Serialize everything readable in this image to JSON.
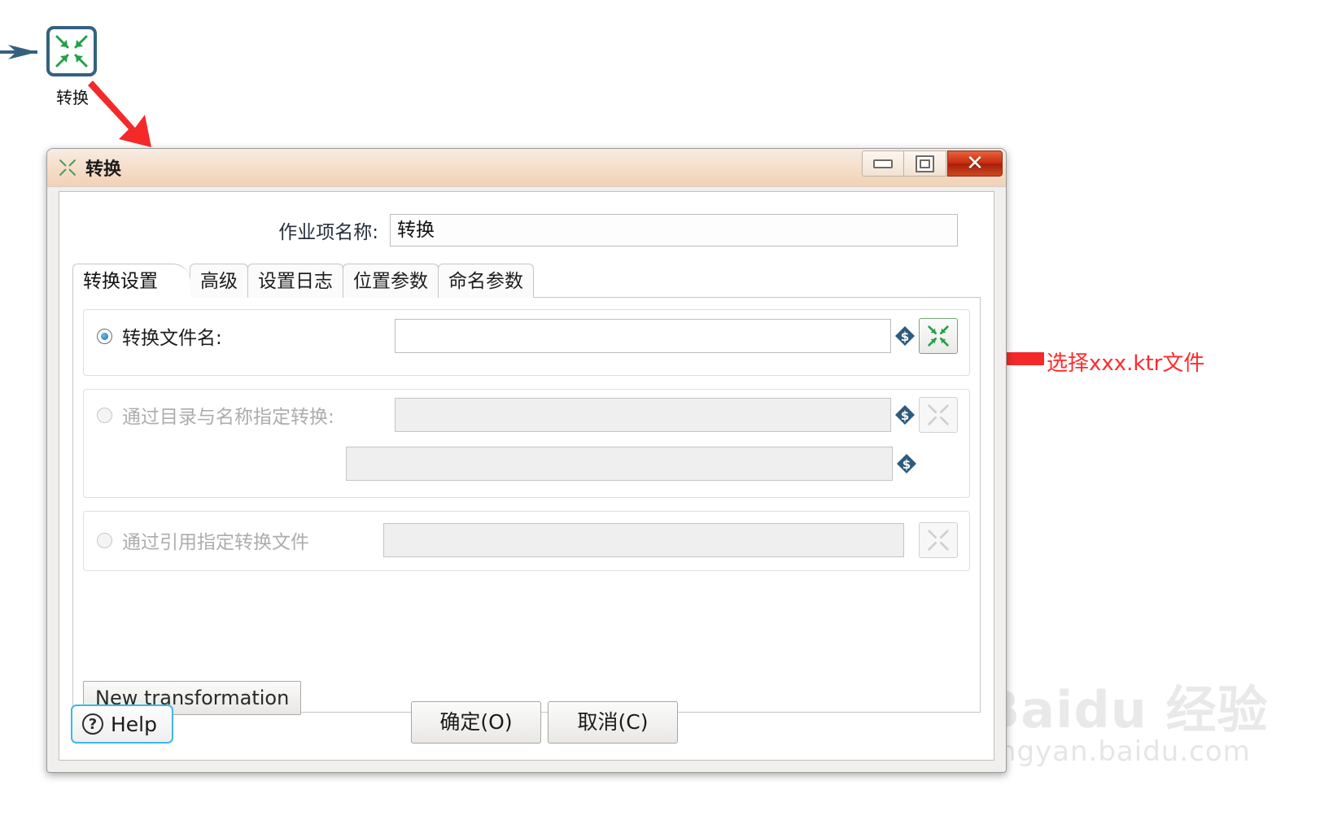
{
  "canvas": {
    "job_entry": {
      "label": "转换",
      "icon": "transformation-icon"
    },
    "annotation": {
      "text": "选择xxx.ktr文件",
      "color": "#ff2b2b"
    }
  },
  "watermark": {
    "main": "Baidu 经验",
    "sub": "jingyan.baidu.com"
  },
  "dialog": {
    "title": "转换",
    "title_icon": "transformation-icon",
    "window_buttons": {
      "minimize": "minimize-icon",
      "maximize": "maximize-icon",
      "close": "✕"
    },
    "name_field": {
      "label": "作业项名称:",
      "value": "转换"
    },
    "tabs": [
      {
        "label": "转换设置",
        "active": true
      },
      {
        "label": "高级",
        "active": false
      },
      {
        "label": "设置日志",
        "active": false
      },
      {
        "label": "位置参数",
        "active": false
      },
      {
        "label": "命名参数",
        "active": false
      }
    ],
    "options": [
      {
        "label": "转换文件名:",
        "selected": true,
        "enabled": true,
        "value": "",
        "var_icon": "dollar-variable-icon",
        "browse_icon": "transformation-icon"
      },
      {
        "label": "通过目录与名称指定转换:",
        "selected": false,
        "enabled": false,
        "value": "",
        "value2": "",
        "var_icon": "dollar-variable-icon",
        "var_icon2": "dollar-variable-icon",
        "browse_icon": "transformation-icon"
      },
      {
        "label": "通过引用指定转换文件",
        "selected": false,
        "enabled": false,
        "value": "",
        "browse_icon": "transformation-icon"
      }
    ],
    "new_transformation_button": "New transformation",
    "footer": {
      "help": "Help",
      "help_glyph": "?",
      "ok": "确定(O)",
      "cancel": "取消(C)"
    }
  },
  "colors": {
    "accent_green": "#22a14a",
    "entry_border": "#35617f",
    "annotation_red": "#ff2b2b",
    "titlebar": "#f5ddc8"
  }
}
